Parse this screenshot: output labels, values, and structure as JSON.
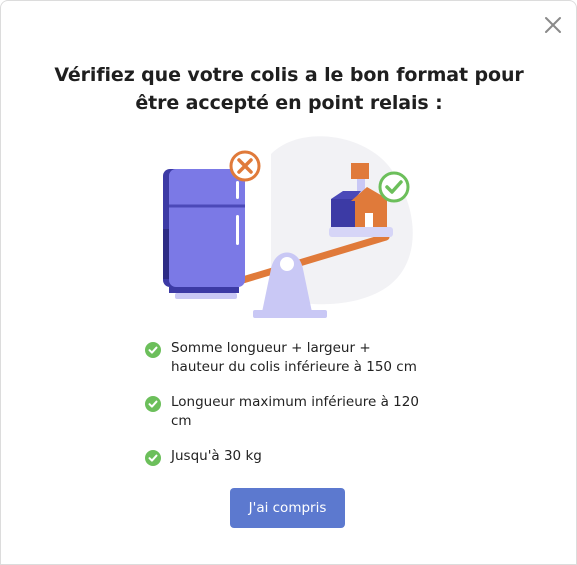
{
  "dialog": {
    "close_icon": "close-icon",
    "title": "Vérifiez que votre colis a le bon format pour être accepté en point relais :",
    "illustration": {
      "description_icons": [
        "fridge-icon",
        "cross-circle-icon",
        "parcel-icon",
        "check-circle-icon",
        "seesaw-icon"
      ]
    },
    "checklist": [
      {
        "icon": "check-circle-icon",
        "text": "Somme longueur + largeur + hauteur du colis inférieure à 150 cm"
      },
      {
        "icon": "check-circle-icon",
        "text": "Longueur maximum inférieure à 120 cm"
      },
      {
        "icon": "check-circle-icon",
        "text": "Jusqu'à 30 kg"
      }
    ],
    "confirm_button": "J'ai compris"
  },
  "colors": {
    "accent_button": "#5c79cf",
    "check_green": "#6cbf5b",
    "cross_orange": "#e07a3a",
    "fridge_purple": "#7b79e6",
    "scale_lavender": "#c9c8f5"
  }
}
